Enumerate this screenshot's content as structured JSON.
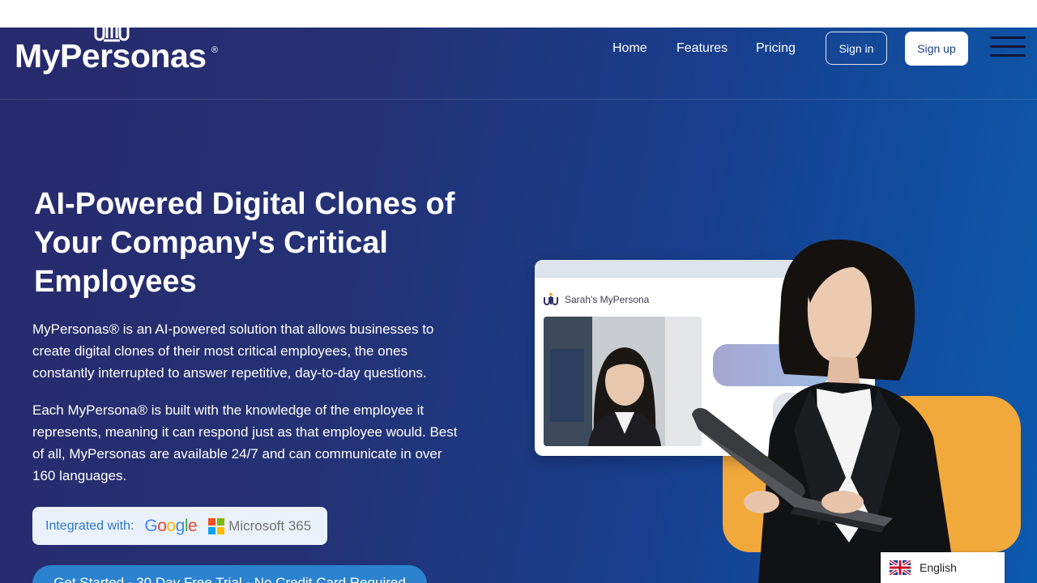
{
  "brand": {
    "logo_text": "MyPersonas",
    "logo_reg": "®"
  },
  "nav": {
    "items": [
      {
        "label": "Home"
      },
      {
        "label": "Features"
      },
      {
        "label": "Pricing"
      }
    ],
    "sign_in": "Sign in",
    "sign_up": "Sign up"
  },
  "hero": {
    "headline": "AI-Powered Digital Clones of Your Company's Critical Employees",
    "paragraph_1": "MyPersonas® is an AI-powered solution that allows businesses to create digital clones of their most critical employees, the ones constantly interrupted to answer repetitive, day-to-day questions.",
    "paragraph_2": "Each MyPersona® is built with the knowledge of the employee it represents, meaning it can respond just as that employee would. Best of all, MyPersonas are available 24/7 and can communicate in over 160 languages.",
    "integrated_label": "Integrated with:",
    "integrations": [
      "Google",
      "Microsoft 365"
    ],
    "cta": "Get Started - 30 Day Free Trial - No Credit Card Required"
  },
  "preview": {
    "persona_name": "Sarah's MyPersona"
  },
  "language": {
    "selected": "English",
    "flag_icon": "uk-flag-icon"
  },
  "colors": {
    "hero_start": "#272a6c",
    "hero_end": "#0c5aae",
    "accent_orange": "#f2a93b",
    "cta_blue": "#2b82cf"
  }
}
